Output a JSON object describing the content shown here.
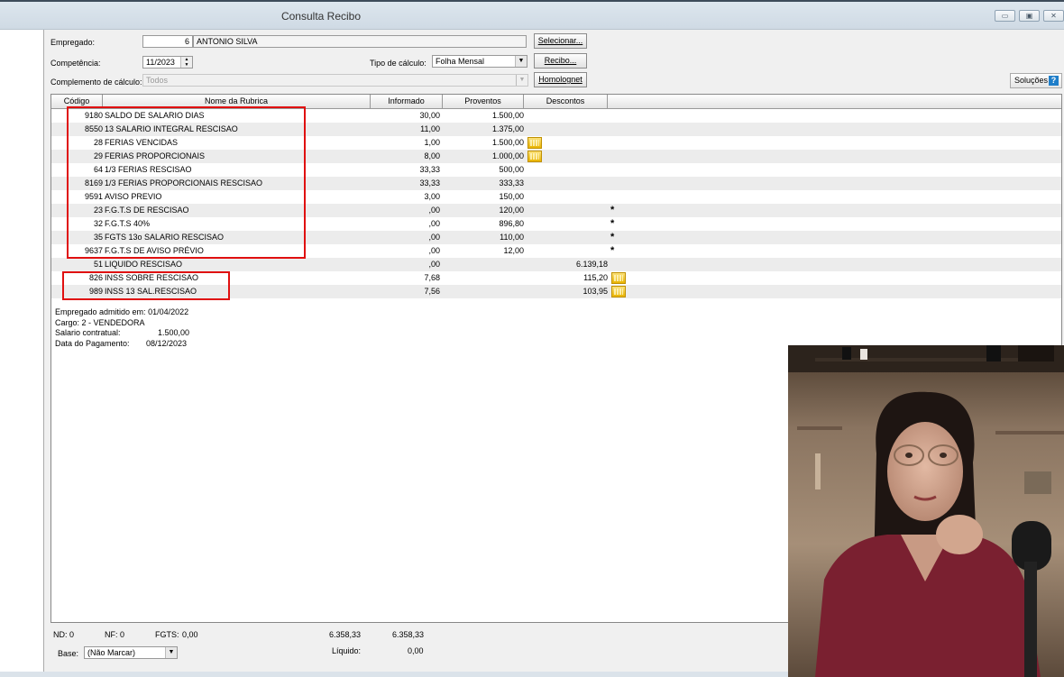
{
  "window": {
    "title": "Consulta Recibo",
    "controls": {
      "minimize": "▭",
      "maximize": "▣",
      "close": "✕"
    }
  },
  "form": {
    "empregado_label": "Empregado:",
    "empregado_code": "6",
    "empregado_name": "ANTONIO SILVA",
    "competencia_label": "Competência:",
    "competencia_value": "11/2023",
    "tipo_label": "Tipo de cálculo:",
    "tipo_value": "Folha Mensal",
    "complemento_label": "Complemento de cálculo:",
    "complemento_value": "Todos"
  },
  "buttons": {
    "selecionar": "Selecionar...",
    "recibo": "Recibo...",
    "homolognet": "Homolognet",
    "solucoes": "Soluções"
  },
  "table": {
    "headers": {
      "codigo": "Código",
      "nome": "Nome da Rubrica",
      "informado": "Informado",
      "proventos": "Proventos",
      "descontos": "Descontos"
    },
    "rows": [
      {
        "codigo": "9180",
        "nome": "SALDO DE SALARIO DIAS",
        "informado": "30,00",
        "proventos": "1.500,00",
        "descontos": "",
        "calc": false,
        "mark": ""
      },
      {
        "codigo": "8550",
        "nome": "13 SALARIO INTEGRAL RESCISAO",
        "informado": "11,00",
        "proventos": "1.375,00",
        "descontos": "",
        "calc": false,
        "mark": ""
      },
      {
        "codigo": "28",
        "nome": "FERIAS VENCIDAS",
        "informado": "1,00",
        "proventos": "1.500,00",
        "descontos": "",
        "calc": true,
        "mark": ""
      },
      {
        "codigo": "29",
        "nome": "FERIAS PROPORCIONAIS",
        "informado": "8,00",
        "proventos": "1.000,00",
        "descontos": "",
        "calc": true,
        "mark": ""
      },
      {
        "codigo": "64",
        "nome": "1/3 FERIAS RESCISAO",
        "informado": "33,33",
        "proventos": "500,00",
        "descontos": "",
        "calc": false,
        "mark": ""
      },
      {
        "codigo": "8169",
        "nome": "1/3 FERIAS PROPORCIONAIS RESCISAO",
        "informado": "33,33",
        "proventos": "333,33",
        "descontos": "",
        "calc": false,
        "mark": ""
      },
      {
        "codigo": "9591",
        "nome": "AVISO PREVIO",
        "informado": "3,00",
        "proventos": "150,00",
        "descontos": "",
        "calc": false,
        "mark": ""
      },
      {
        "codigo": "23",
        "nome": "F.G.T.S DE RESCISAO",
        "informado": ",00",
        "proventos": "120,00",
        "descontos": "",
        "calc": false,
        "mark": "*"
      },
      {
        "codigo": "32",
        "nome": "F.G.T.S 40%",
        "informado": ",00",
        "proventos": "896,80",
        "descontos": "",
        "calc": false,
        "mark": "*"
      },
      {
        "codigo": "35",
        "nome": "FGTS 13o SALARIO RESCISAO",
        "informado": ",00",
        "proventos": "110,00",
        "descontos": "",
        "calc": false,
        "mark": "*"
      },
      {
        "codigo": "9637",
        "nome": "F.G.T.S DE AVISO PRÉVIO",
        "informado": ",00",
        "proventos": "12,00",
        "descontos": "",
        "calc": false,
        "mark": "*"
      },
      {
        "codigo": "51",
        "nome": "LIQUIDO RESCISAO",
        "informado": ",00",
        "proventos": "",
        "descontos": "6.139,18",
        "calc": false,
        "mark": ""
      },
      {
        "codigo": "826",
        "nome": "INSS SOBRE RESCISAO",
        "informado": "7,68",
        "proventos": "",
        "descontos": "115,20",
        "calc": true,
        "mark": ""
      },
      {
        "codigo": "989",
        "nome": "INSS 13 SAL.RESCISAO",
        "informado": "7,56",
        "proventos": "",
        "descontos": "103,95",
        "calc": true,
        "mark": ""
      }
    ]
  },
  "info": {
    "admitido_label": "Empregado admitido em:",
    "admitido_value": "01/04/2022",
    "cargo": "Cargo: 2 - VENDEDORA",
    "salario_label": "Salario contratual:",
    "salario_value": "1.500,00",
    "pagamento_label": "Data do Pagamento:",
    "pagamento_value": "08/12/2023"
  },
  "footer": {
    "nd": "ND: 0",
    "nf": "NF: 0",
    "fgts_label": "FGTS:",
    "fgts_value": "0,00",
    "total_proventos": "6.358,33",
    "total_descontos": "6.358,33",
    "liquido_label": "Líquido:",
    "liquido_value": "0,00",
    "base_label": "Base:",
    "base_value": "(Não Marcar)"
  }
}
